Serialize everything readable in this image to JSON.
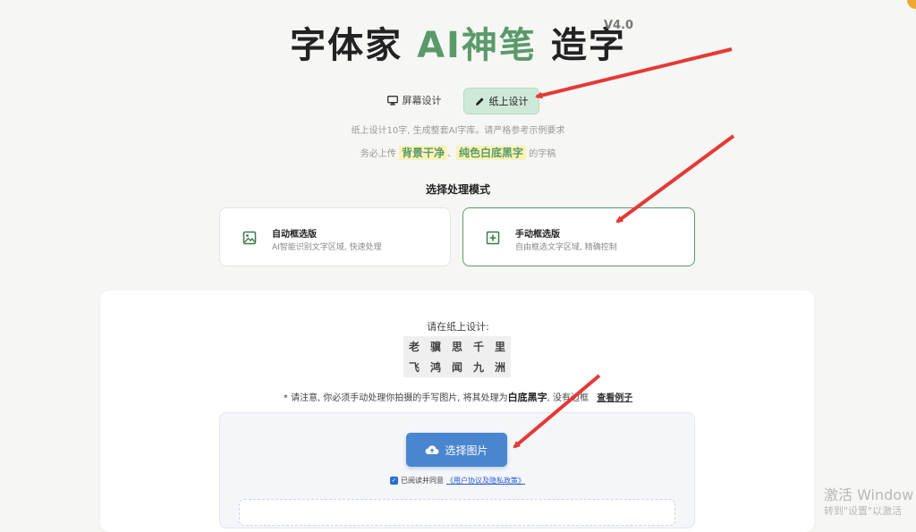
{
  "header": {
    "title_part1": "字体家",
    "title_accent": "AI神笔",
    "title_part2": "造字",
    "version": "V4.0"
  },
  "toggle": {
    "screen_label": "屏幕设计",
    "paper_label": "纸上设计"
  },
  "hints": {
    "line1": "纸上设计10字, 生成整套AI字库。请严格参考示例要求",
    "line2_prefix": "务必上传",
    "highlight1": "背景干净",
    "separator": "、",
    "highlight2": "纯色白底黑字",
    "line2_suffix": "的字稿"
  },
  "mode": {
    "title": "选择处理模式",
    "auto": {
      "title": "自动框选版",
      "desc": "AI智能识别文字区域, 快速处理"
    },
    "manual": {
      "title": "手动框选版",
      "desc": "自由框选文字区域, 精确控制"
    }
  },
  "panel": {
    "design_prompt": "请在纸上设计:",
    "characters": [
      "老",
      "骥",
      "思",
      "千",
      "里",
      "飞",
      "鸿",
      "闻",
      "九",
      "洲"
    ],
    "notice_prefix": "* 请注意, 你必须手动处理你拍摄的手写图片, 将其处理为",
    "notice_bold": "白底黑字",
    "notice_suffix": ", 没有边框",
    "example_link": "查看例子",
    "choose_button": "选择图片",
    "agree_prefix": "已阅读并同意",
    "agree_link": "《用户协议及隐私政策》"
  },
  "watermark": {
    "line1": "激活 Window",
    "line2": "转到\"设置\"以激活"
  },
  "colors": {
    "accent_green": "#5a9a6a",
    "toggle_active_bg": "#cfe9d9",
    "button_blue": "#4a86cf",
    "arrow_red": "#e53935"
  }
}
